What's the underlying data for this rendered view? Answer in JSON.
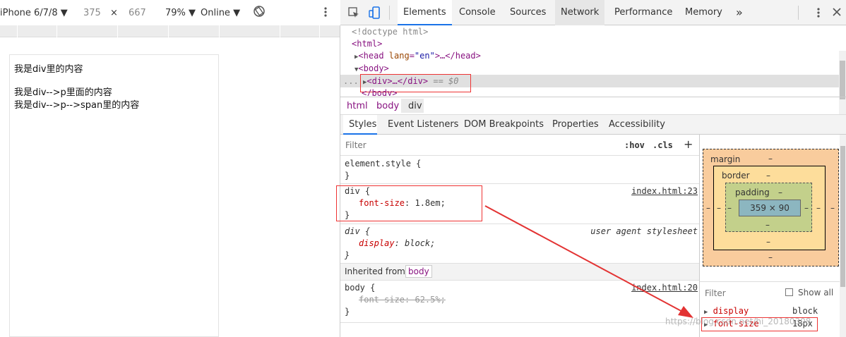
{
  "device_toolbar": {
    "device": "iPhone 6/7/8",
    "width": "375",
    "times": "×",
    "height": "667",
    "zoom": "79%",
    "network": "Online"
  },
  "viewport_content": {
    "line1": "我是div里的内容",
    "line2": "我是div-->p里面的内容",
    "line3": "我是div-->p-->span里的内容"
  },
  "devtools_tabs": [
    "Elements",
    "Console",
    "Sources",
    "Network",
    "Performance",
    "Memory"
  ],
  "more_tabs": "»",
  "elements_tree": {
    "doctype": "<!doctype html>",
    "html_open": "<html>",
    "head_tag": "<head",
    "head_attr": "lang",
    "head_val": "\"en\"",
    "head_rest": ">…</head>",
    "body_open": "<body>",
    "div_line": "<div>…</div>",
    "div_eq": " == $0",
    "body_close": "</body>",
    "dots": "..."
  },
  "breadcrumbs": [
    "html",
    "body",
    "div"
  ],
  "sub_tabs": [
    "Styles",
    "Event Listeners",
    "DOM Breakpoints",
    "Properties",
    "Accessibility"
  ],
  "styles_filter": {
    "placeholder": "Filter",
    "hov": ":hov",
    "cls": ".cls",
    "plus": "+"
  },
  "rules": {
    "element_style": {
      "selector": "element.style {",
      "close": "}"
    },
    "div_rule": {
      "selector": "div {",
      "prop": "font-size",
      "value": "1.8em;",
      "close": "}",
      "source": "index.html:23"
    },
    "ua_rule": {
      "selector": "div {",
      "prop": "display",
      "value": "block;",
      "close": "}",
      "source": "user agent stylesheet"
    },
    "inherited": {
      "label": "Inherited from",
      "from": "body"
    },
    "body_rule": {
      "selector": "body {",
      "prop": "font-size",
      "value": "62.5%;",
      "close": "}",
      "source": "index.html:20"
    }
  },
  "box_model": {
    "margin_label": "margin",
    "border_label": "border",
    "padding_label": "padding",
    "dash": "–",
    "content": "359 × 90"
  },
  "computed": {
    "filter_placeholder": "Filter",
    "show_all": "Show all",
    "props": [
      {
        "name": "display",
        "value": "block"
      },
      {
        "name": "font-size",
        "value": "18px"
      }
    ]
  },
  "watermark": "https://blog.csdn.net/hi_20180308",
  "colors": {
    "accent": "#1a73e8",
    "annotation": "#e33333",
    "margin_bg": "#f9cc9d",
    "border_bg": "#fddd9b",
    "padding_bg": "#c3d08b",
    "content_bg": "#8cb6c0"
  }
}
